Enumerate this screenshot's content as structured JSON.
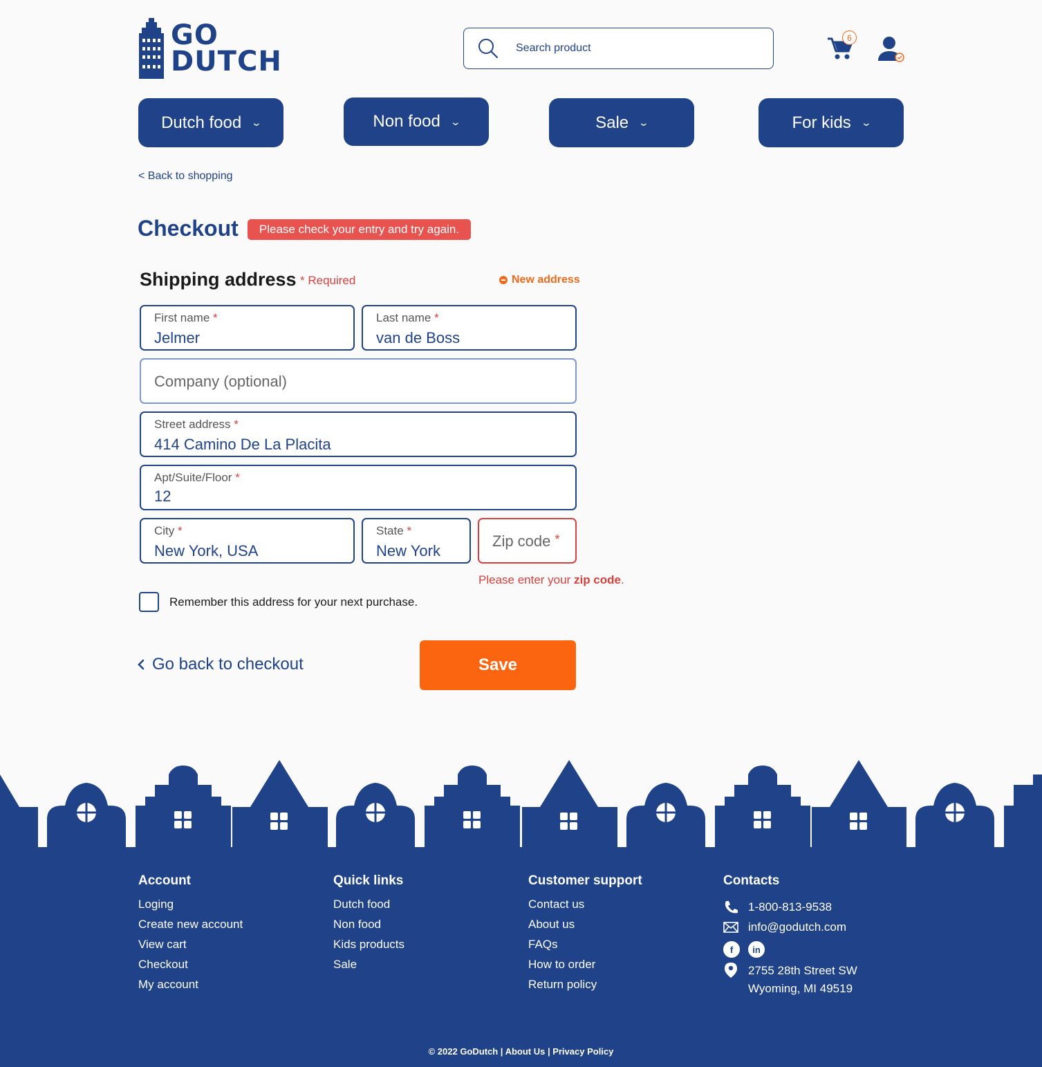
{
  "header": {
    "logo_line1": "GO",
    "logo_line2": "DUTCH",
    "search_placeholder": "Search product",
    "cart_count": "6"
  },
  "nav": [
    {
      "label": "Dutch food"
    },
    {
      "label": "Non food"
    },
    {
      "label": "Sale"
    },
    {
      "label": "For kids"
    }
  ],
  "back_to_shopping": "< Back to shopping",
  "checkout": {
    "title": "Checkout",
    "error": "Please check your entry and try again."
  },
  "shipping": {
    "title": "Shipping address",
    "required": "* Required",
    "new_address": "New address",
    "fields": {
      "first_name": {
        "label": "First name",
        "value": "Jelmer"
      },
      "last_name": {
        "label": "Last name",
        "value": "van de Boss"
      },
      "company": {
        "placeholder": "Company (optional)"
      },
      "street": {
        "label": "Street address",
        "value": "414 Camino De La Placita"
      },
      "apt": {
        "label": "Apt/Suite/Floor",
        "value": "12"
      },
      "city": {
        "label": "City",
        "value": "New York, USA"
      },
      "state": {
        "label": "State",
        "value": "New York"
      },
      "zip": {
        "placeholder": "Zip code"
      }
    },
    "star": "*",
    "zip_error_prefix": "Please enter your ",
    "zip_error_bold": "zip code",
    "zip_error_suffix": ".",
    "remember": "Remember this address for your next purchase."
  },
  "actions": {
    "go_back": "Go back to checkout",
    "save": "Save"
  },
  "footer": {
    "account": {
      "title": "Account",
      "links": [
        "Loging",
        "Create new account",
        "View cart",
        "Checkout",
        "My account"
      ]
    },
    "quick_links": {
      "title": "Quick links",
      "links": [
        "Dutch food",
        "Non food",
        "Kids products",
        "Sale"
      ]
    },
    "support": {
      "title": "Customer support",
      "links": [
        "Contact us",
        "About us",
        "FAQs",
        "How to order",
        "Return policy"
      ]
    },
    "contacts": {
      "title": "Contacts",
      "phone": "1-800-813-9538",
      "email": "info@godutch.com",
      "address_line1": "2755 28th Street SW",
      "address_line2": "Wyoming, MI 49519"
    },
    "copyright": "© 2022 GoDutch |  About Us |  Privacy Policy"
  },
  "colors": {
    "brand": "#1f4288",
    "accent": "#fc6510",
    "error": "#d8403e"
  }
}
